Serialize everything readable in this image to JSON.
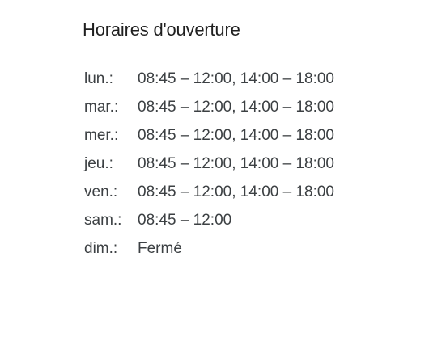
{
  "hours_panel": {
    "title": "Horaires d'ouverture",
    "rows": [
      {
        "day": "lun.:",
        "hours": "08:45 – 12:00, 14:00 – 18:00"
      },
      {
        "day": "mar.:",
        "hours": "08:45 – 12:00, 14:00 – 18:00"
      },
      {
        "day": "mer.:",
        "hours": "08:45 – 12:00, 14:00 – 18:00"
      },
      {
        "day": "jeu.:",
        "hours": "08:45 – 12:00, 14:00 – 18:00"
      },
      {
        "day": "ven.:",
        "hours": "08:45 – 12:00, 14:00 – 18:00"
      },
      {
        "day": "sam.:",
        "hours": "08:45 – 12:00"
      },
      {
        "day": "dim.:",
        "hours": "Fermé"
      }
    ]
  }
}
